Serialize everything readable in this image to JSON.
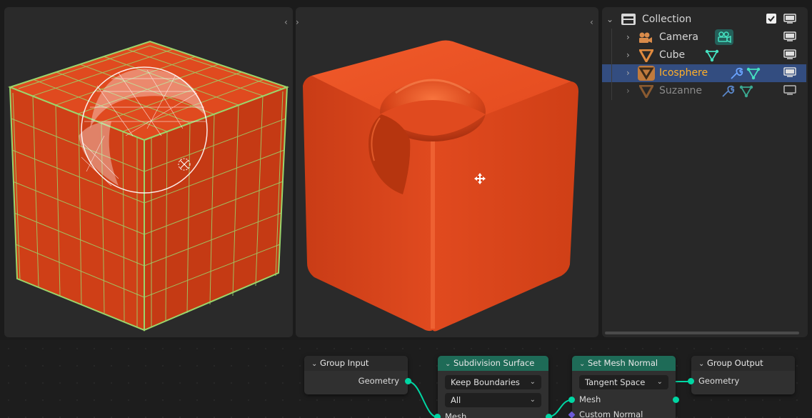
{
  "outliner": {
    "rows": [
      {
        "label": "Collection",
        "icon": "collection-icon"
      },
      {
        "label": "Camera",
        "icon": "camera-icon",
        "extra": "camera-data-icon"
      },
      {
        "label": "Cube",
        "icon": "mesh-object-icon",
        "extra": "mesh-data-icon"
      },
      {
        "label": "Icosphere",
        "icon": "mesh-object-icon",
        "extra": "modifier-wrench-icon",
        "selected": true
      },
      {
        "label": "Suzanne",
        "icon": "mesh-object-icon",
        "extra": "modifier-wrench-icon",
        "dim": true
      }
    ]
  },
  "nodes": {
    "group_input": {
      "title": "Group Input",
      "outputs": [
        "Geometry"
      ]
    },
    "subdivision": {
      "title": "Subdivision Surface",
      "dropdowns": [
        "Keep Boundaries",
        "All"
      ],
      "inputs": [
        "Mesh"
      ]
    },
    "set_mesh_normal": {
      "title": "Set Mesh Normal",
      "dropdowns": [
        "Tangent Space"
      ],
      "inputs": [
        "Mesh",
        "Custom Normal"
      ]
    },
    "group_output": {
      "title": "Group Output",
      "inputs": [
        "Geometry"
      ]
    }
  },
  "colors": {
    "accent_selected": "#334d80",
    "selected_text": "#ffaf29",
    "node_header_green": "#1e6b57",
    "socket_geometry": "#00d6a3",
    "mesh_orange": "#d8461e"
  }
}
